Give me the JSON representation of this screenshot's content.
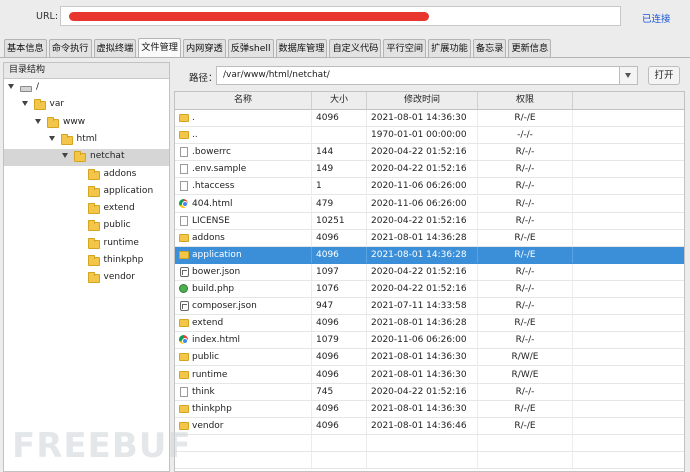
{
  "urlbar": {
    "label": "URL:",
    "status": "已连接"
  },
  "tabs": [
    "基本信息",
    "命令执行",
    "虚拟终端",
    "文件管理",
    "内网穿透",
    "反弹shell",
    "数据库管理",
    "自定义代码",
    "平行空间",
    "扩展功能",
    "备忘录",
    "更新信息"
  ],
  "active_tab": "文件管理",
  "tree": {
    "title": "目录结构",
    "nodes": [
      {
        "label": "/",
        "depth": 0,
        "type": "drive",
        "expanded": true
      },
      {
        "label": "var",
        "depth": 1,
        "type": "folder",
        "expanded": true
      },
      {
        "label": "www",
        "depth": 2,
        "type": "folder",
        "expanded": true
      },
      {
        "label": "html",
        "depth": 3,
        "type": "folder",
        "expanded": true
      },
      {
        "label": "netchat",
        "depth": 4,
        "type": "folder",
        "expanded": true,
        "selected": true
      },
      {
        "label": "addons",
        "depth": 5,
        "type": "folder"
      },
      {
        "label": "application",
        "depth": 5,
        "type": "folder"
      },
      {
        "label": "extend",
        "depth": 5,
        "type": "folder"
      },
      {
        "label": "public",
        "depth": 5,
        "type": "folder"
      },
      {
        "label": "runtime",
        "depth": 5,
        "type": "folder"
      },
      {
        "label": "thinkphp",
        "depth": 5,
        "type": "folder"
      },
      {
        "label": "vendor",
        "depth": 5,
        "type": "folder"
      }
    ]
  },
  "path": {
    "label": "路径：",
    "value": "/var/www/html/netchat/",
    "open_label": "打开"
  },
  "table": {
    "headers": [
      "名称",
      "大小",
      "修改时间",
      "权限"
    ],
    "rows": [
      {
        "name": ".",
        "size": "4096",
        "time": "2021-08-01 14:36:30",
        "perm": "R/-/E",
        "icon": "folder"
      },
      {
        "name": "..",
        "size": "",
        "time": "1970-01-01 00:00:00",
        "perm": "-/-/-",
        "icon": "folder"
      },
      {
        "name": ".bowerrc",
        "size": "144",
        "time": "2020-04-22 01:52:16",
        "perm": "R/-/-",
        "icon": "file"
      },
      {
        "name": ".env.sample",
        "size": "149",
        "time": "2020-04-22 01:52:16",
        "perm": "R/-/-",
        "icon": "file"
      },
      {
        "name": ".htaccess",
        "size": "1",
        "time": "2020-11-06 06:26:00",
        "perm": "R/-/-",
        "icon": "file"
      },
      {
        "name": "404.html",
        "size": "479",
        "time": "2020-11-06 06:26:00",
        "perm": "R/-/-",
        "icon": "chrome"
      },
      {
        "name": "LICENSE",
        "size": "10251",
        "time": "2020-04-22 01:52:16",
        "perm": "R/-/-",
        "icon": "file"
      },
      {
        "name": "addons",
        "size": "4096",
        "time": "2021-08-01 14:36:28",
        "perm": "R/-/E",
        "icon": "folder"
      },
      {
        "name": "application",
        "size": "4096",
        "time": "2021-08-01 14:36:28",
        "perm": "R/-/E",
        "icon": "folder",
        "selected": true
      },
      {
        "name": "bower.json",
        "size": "1097",
        "time": "2020-04-22 01:52:16",
        "perm": "R/-/-",
        "icon": "json"
      },
      {
        "name": "build.php",
        "size": "1076",
        "time": "2020-04-22 01:52:16",
        "perm": "R/-/-",
        "icon": "php"
      },
      {
        "name": "composer.json",
        "size": "947",
        "time": "2021-07-11 14:33:58",
        "perm": "R/-/-",
        "icon": "json"
      },
      {
        "name": "extend",
        "size": "4096",
        "time": "2021-08-01 14:36:28",
        "perm": "R/-/E",
        "icon": "folder"
      },
      {
        "name": "index.html",
        "size": "1079",
        "time": "2020-11-06 06:26:00",
        "perm": "R/-/-",
        "icon": "chrome"
      },
      {
        "name": "public",
        "size": "4096",
        "time": "2021-08-01 14:36:30",
        "perm": "R/W/E",
        "icon": "folder"
      },
      {
        "name": "runtime",
        "size": "4096",
        "time": "2021-08-01 14:36:30",
        "perm": "R/W/E",
        "icon": "folder"
      },
      {
        "name": "think",
        "size": "745",
        "time": "2020-04-22 01:52:16",
        "perm": "R/-/-",
        "icon": "file"
      },
      {
        "name": "thinkphp",
        "size": "4096",
        "time": "2021-08-01 14:36:30",
        "perm": "R/-/E",
        "icon": "folder"
      },
      {
        "name": "vendor",
        "size": "4096",
        "time": "2021-08-01 14:36:46",
        "perm": "R/-/E",
        "icon": "folder"
      }
    ]
  },
  "watermark": "FREEBUF"
}
